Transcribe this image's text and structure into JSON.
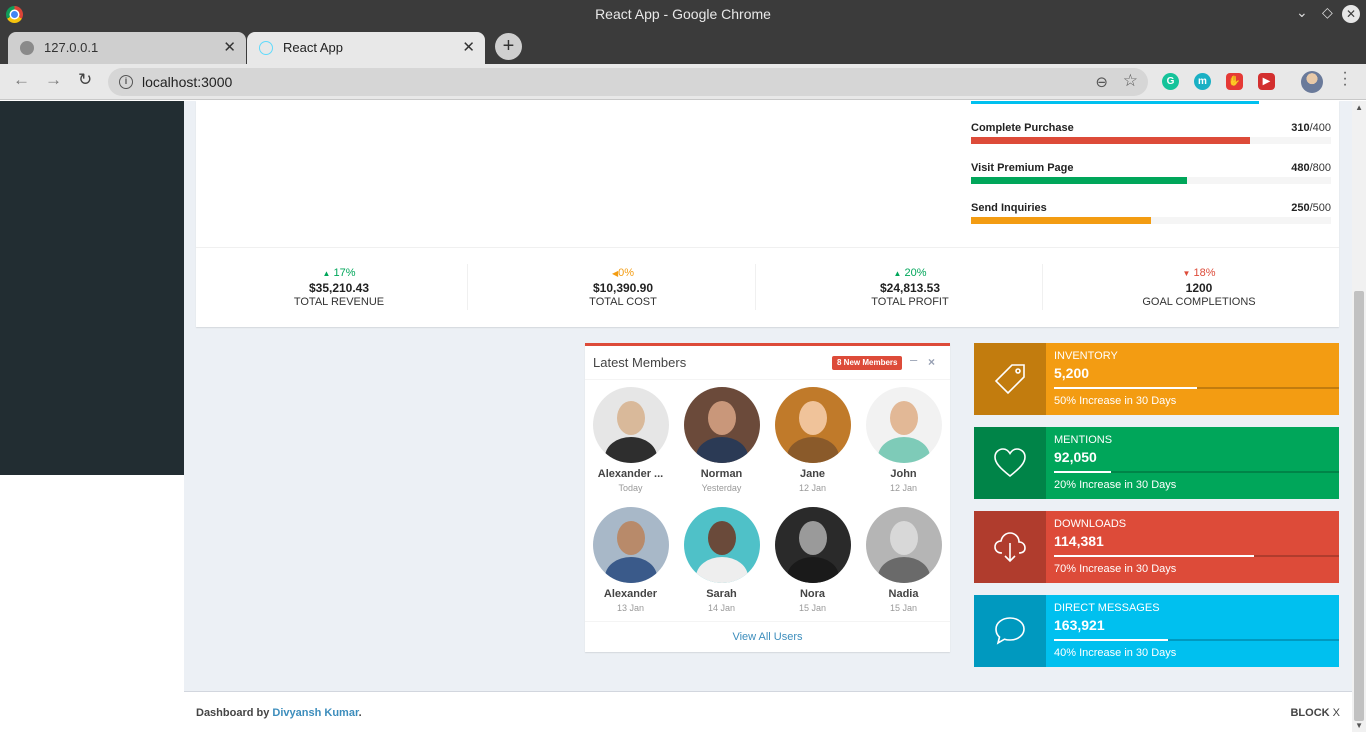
{
  "window": {
    "title": "React App - Google Chrome"
  },
  "tabs": [
    {
      "label": "127.0.0.1"
    },
    {
      "label": "React App"
    }
  ],
  "address_bar": {
    "url": "localhost:3000"
  },
  "goals": [
    {
      "label": "Complete Purchase",
      "current": "310",
      "total": "/400",
      "fraction": 0.775,
      "color": "#dd4b39"
    },
    {
      "label": "Visit Premium Page",
      "current": "480",
      "total": "/800",
      "fraction": 0.6,
      "color": "#00a65a"
    },
    {
      "label": "Send Inquiries",
      "current": "250",
      "total": "/500",
      "fraction": 0.5,
      "color": "#f39c12"
    }
  ],
  "stats": [
    {
      "arrow": "▲",
      "percent": "17%",
      "amount": "$35,210.43",
      "label": "TOTAL REVENUE",
      "tone": "green"
    },
    {
      "arrow": "◀",
      "percent": "0%",
      "amount": "$10,390.90",
      "label": "TOTAL COST",
      "tone": "orange"
    },
    {
      "arrow": "▲",
      "percent": "20%",
      "amount": "$24,813.53",
      "label": "TOTAL PROFIT",
      "tone": "green"
    },
    {
      "arrow": "▼",
      "percent": "18%",
      "amount": "1200",
      "label": "GOAL COMPLETIONS",
      "tone": "red"
    }
  ],
  "members": {
    "title": "Latest Members",
    "badge": "8 New Members",
    "footer_link": "View All Users",
    "list": [
      {
        "name": "Alexander ...",
        "date": "Today"
      },
      {
        "name": "Norman",
        "date": "Yesterday"
      },
      {
        "name": "Jane",
        "date": "12 Jan"
      },
      {
        "name": "John",
        "date": "12 Jan"
      },
      {
        "name": "Alexander",
        "date": "13 Jan"
      },
      {
        "name": "Sarah",
        "date": "14 Jan"
      },
      {
        "name": "Nora",
        "date": "15 Jan"
      },
      {
        "name": "Nadia",
        "date": "15 Jan"
      }
    ]
  },
  "info_boxes": [
    {
      "label": "INVENTORY",
      "number": "5,200",
      "progress": 0.5,
      "description": "50% Increase in 30 Days",
      "color": "#f39c12",
      "icon": "tag-icon"
    },
    {
      "label": "MENTIONS",
      "number": "92,050",
      "progress": 0.2,
      "description": "20% Increase in 30 Days",
      "color": "#00a65a",
      "icon": "heart-icon"
    },
    {
      "label": "DOWNLOADS",
      "number": "114,381",
      "progress": 0.7,
      "description": "70% Increase in 30 Days",
      "color": "#dd4b39",
      "icon": "cloud-download-icon"
    },
    {
      "label": "DIRECT MESSAGES",
      "number": "163,921",
      "progress": 0.4,
      "description": "40% Increase in 30 Days",
      "color": "#00c0ef",
      "icon": "chat-bubble-icon"
    }
  ],
  "footer": {
    "credit_prefix": "Dashboard by",
    "credit_name": "Divyansh Kumar",
    "credit_suffix": ".",
    "brand": "BLOCK",
    "brand_suffix": "X"
  }
}
